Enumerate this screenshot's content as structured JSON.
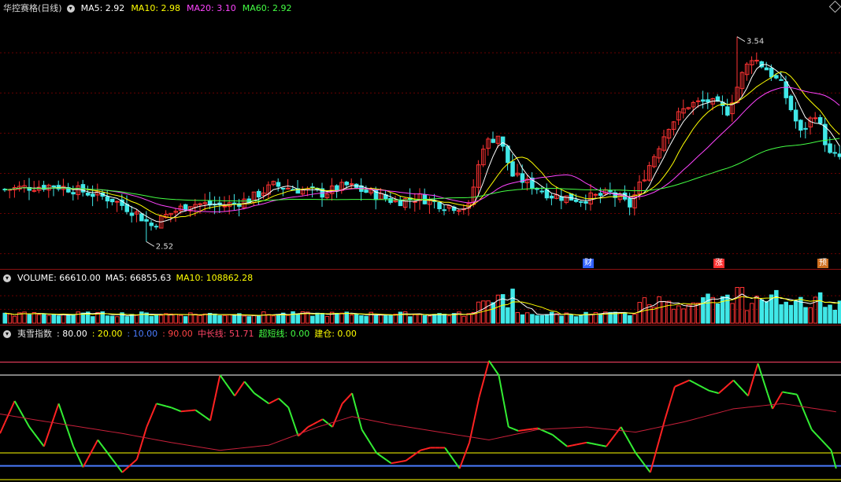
{
  "main": {
    "stock": "华控赛格(日线)",
    "ma": [
      {
        "label": "MA5: 2.92",
        "color": "#ffffff"
      },
      {
        "label": "MA10: 2.98",
        "color": "#ffff00"
      },
      {
        "label": "MA20: 3.10",
        "color": "#ff44ff"
      },
      {
        "label": "MA60: 2.92",
        "color": "#44ff44"
      }
    ],
    "high_label": "3.54",
    "low_label": "2.52",
    "badges": [
      {
        "text": "财",
        "color": "#3060ff"
      },
      {
        "text": "涨",
        "color": "#ff3030"
      },
      {
        "text": "预",
        "color": "#d07020"
      }
    ]
  },
  "volume": {
    "items": [
      {
        "label": "VOLUME: 66610.00",
        "color": "#ffffff"
      },
      {
        "label": "MA5: 66855.63",
        "color": "#ffffff"
      },
      {
        "label": "MA10: 108862.28",
        "color": "#ffff00"
      }
    ]
  },
  "indicator": {
    "name": "夷雪指数",
    "items": [
      {
        "label": ": 80.00",
        "color": "#ffffff"
      },
      {
        "label": ": 20.00",
        "color": "#ffff00"
      },
      {
        "label": ": 10.00",
        "color": "#4a7cff"
      },
      {
        "label": ": 90.00",
        "color": "#ff4444"
      },
      {
        "label": "中长线: 51.71",
        "color": "#ff4466"
      },
      {
        "label": "超短线: 0.00",
        "color": "#44ff44"
      },
      {
        "label": "建仓: 0.00",
        "color": "#ffff00"
      }
    ]
  },
  "chart_data": [
    {
      "type": "candlestick",
      "price_range": [
        2.4,
        3.66
      ],
      "gridlines": [
        3.46,
        3.26,
        3.06,
        2.86,
        2.66,
        2.46
      ],
      "series": [
        "MA5",
        "MA10",
        "MA20",
        "MA60"
      ],
      "high": 3.54,
      "low": 2.52
    },
    {
      "type": "bar",
      "series": [
        "VOLUME",
        "MA5",
        "MA10"
      ],
      "ylim": [
        0,
        160000
      ]
    },
    {
      "type": "line",
      "ylim": [
        0,
        100
      ],
      "reference_levels": [
        90,
        80,
        20,
        10
      ],
      "series": [
        "中长线",
        "超短线"
      ]
    }
  ]
}
